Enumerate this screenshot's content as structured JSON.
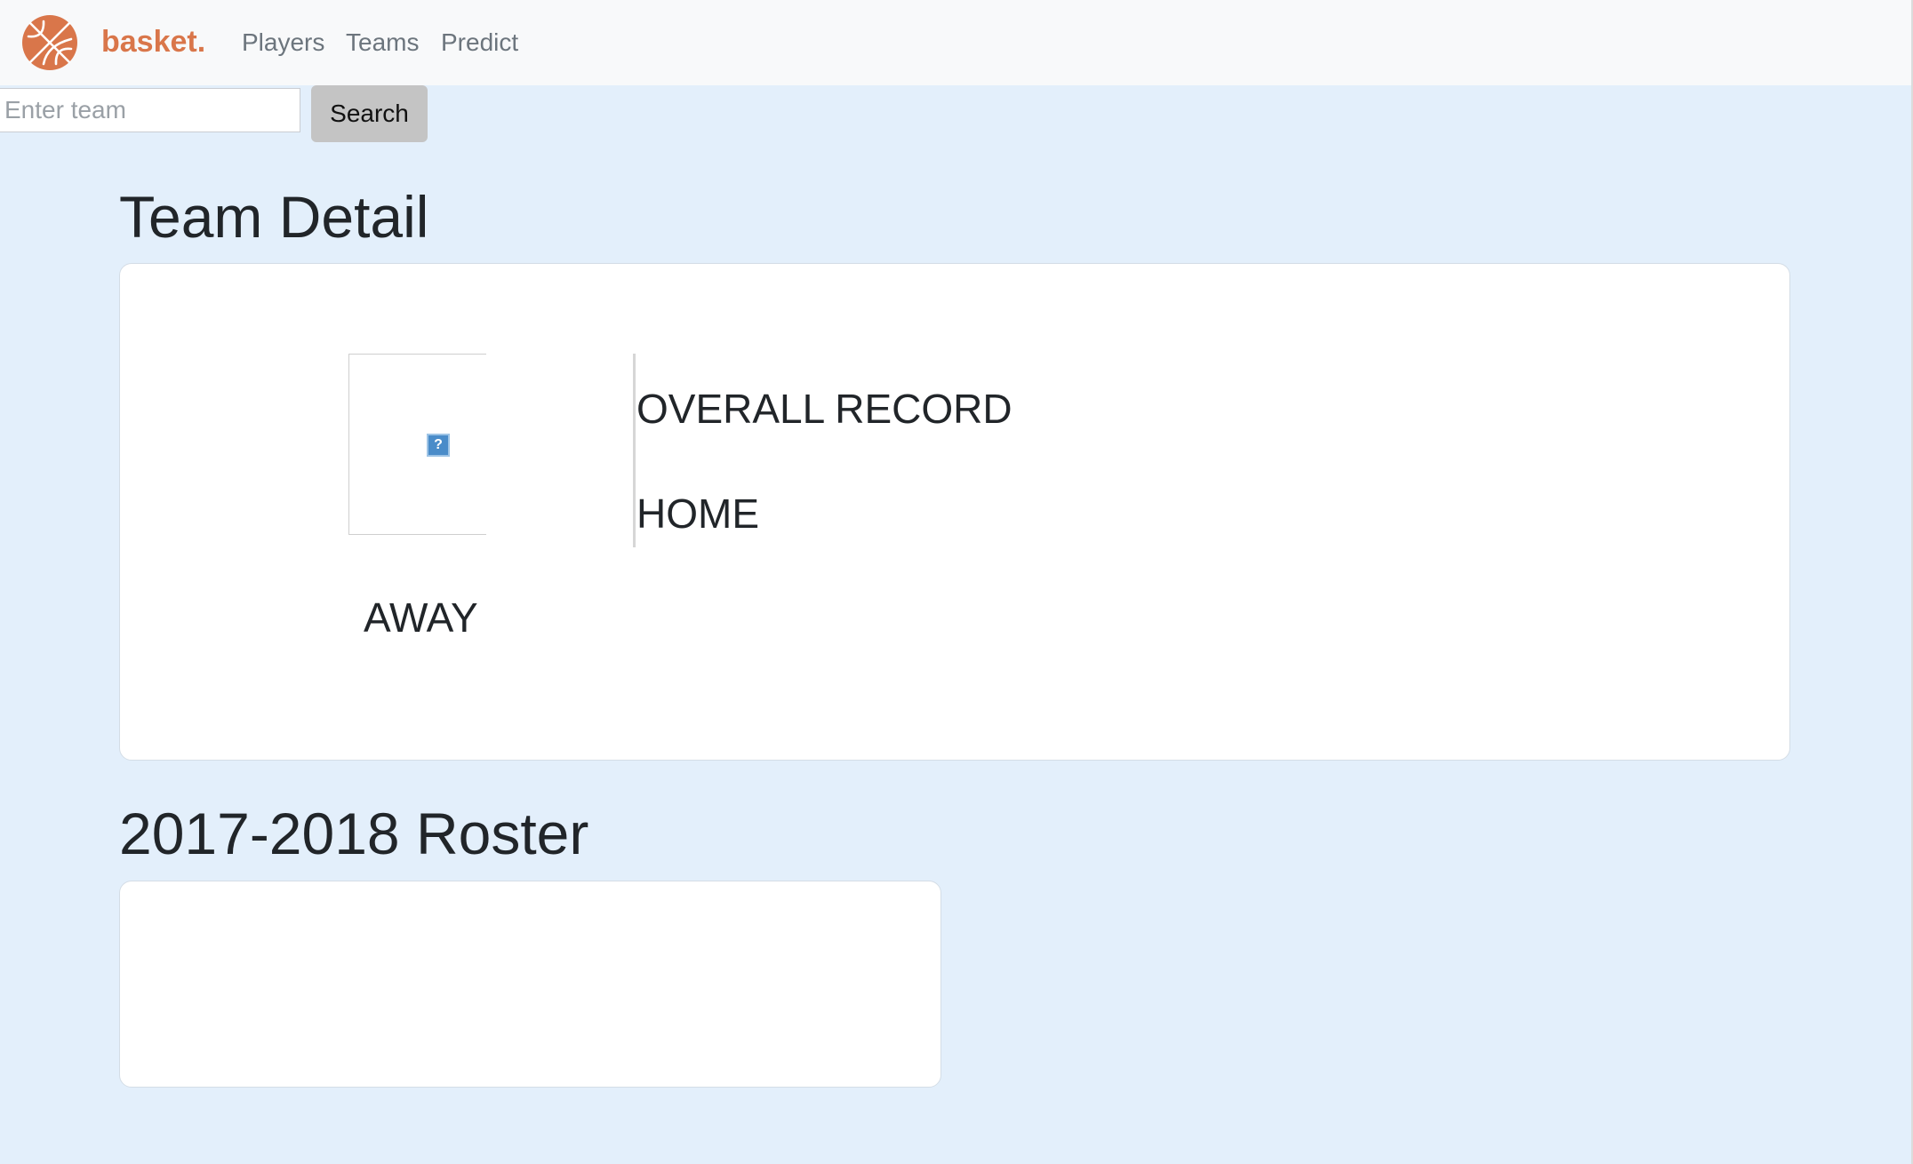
{
  "navbar": {
    "brand": "basket.",
    "links": [
      "Players",
      "Teams",
      "Predict"
    ]
  },
  "search": {
    "placeholder": "Enter team",
    "value": "",
    "button_label": "Search"
  },
  "team_detail": {
    "title": "Team Detail",
    "logo_icon": "broken-image-icon",
    "overall_record_label": "OVERALL RECORD",
    "home_label": "HOME",
    "away_label": "AWAY"
  },
  "roster": {
    "title": "2017-2018 Roster",
    "players": []
  },
  "colors": {
    "brand": "#d9764a",
    "page_background": "#e3effb",
    "navbar_background": "#f8f9fa",
    "nav_link": "#6c757d",
    "search_button": "#c4c4c4",
    "heading_text": "#212529"
  }
}
